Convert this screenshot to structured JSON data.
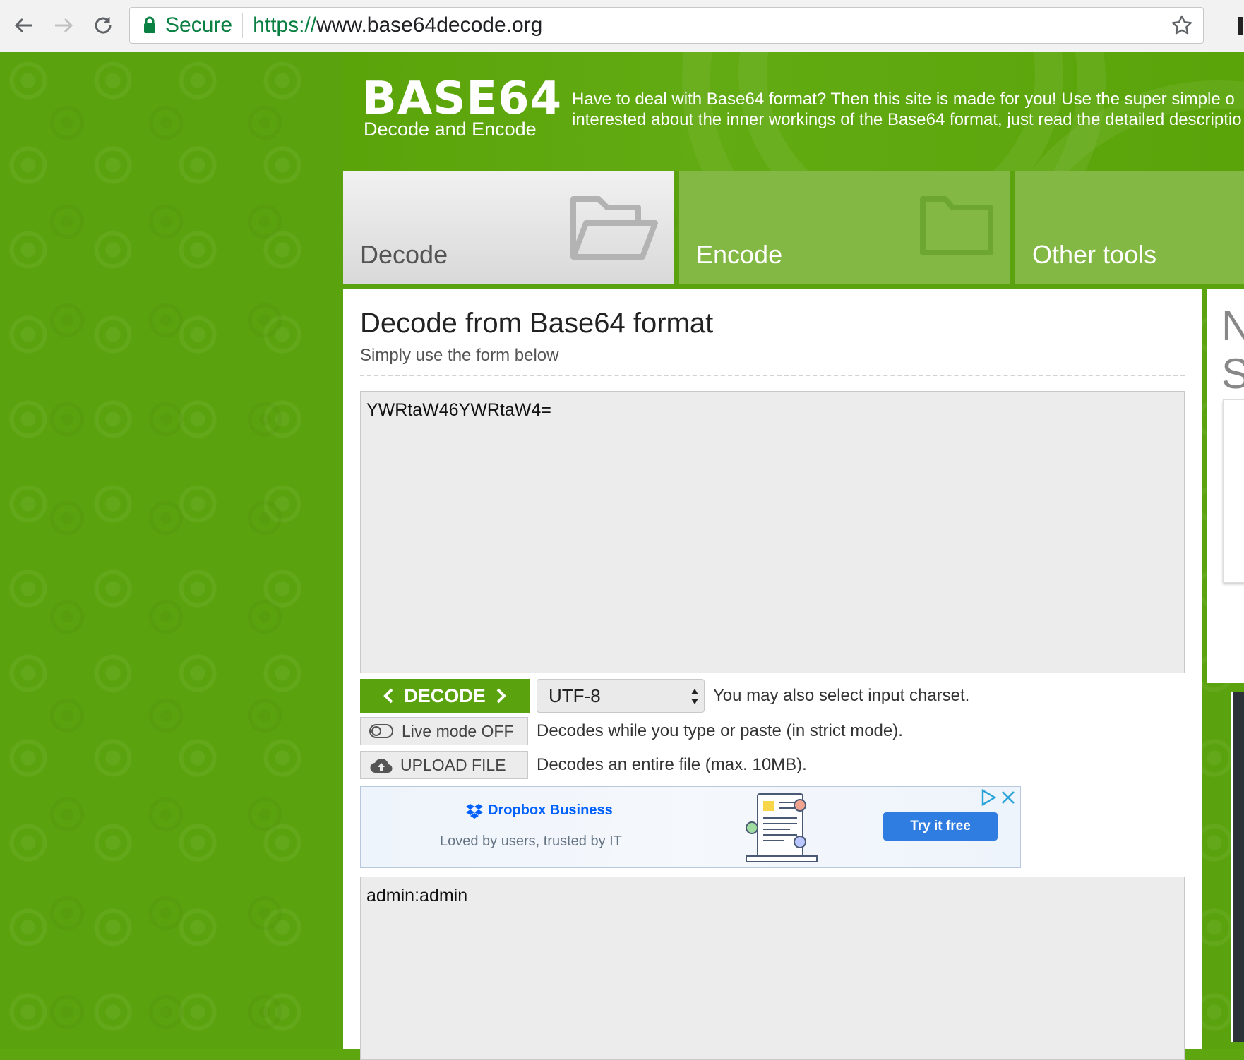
{
  "browser": {
    "secure_label": "Secure",
    "url_scheme": "https://",
    "url_host": "www.base64decode.org"
  },
  "header": {
    "logo_title": "BASE64",
    "logo_subtitle": "Decode and Encode",
    "tagline_line1": "Have to deal with Base64 format? Then this site is made for you! Use the super simple o",
    "tagline_line2": "interested about the inner workings of the Base64 format, just read the detailed descriptio"
  },
  "tabs": [
    {
      "label": "Decode",
      "active": true
    },
    {
      "label": "Encode",
      "active": false
    },
    {
      "label": "Other tools",
      "active": false
    }
  ],
  "main": {
    "title": "Decode from Base64 format",
    "subtitle": "Simply use the form below",
    "input_value": "YWRtaW46YWRtaW4=",
    "decode_button": "DECODE",
    "charset_selected": "UTF-8",
    "charset_help": "You may also select input charset.",
    "live_mode_label": "Live mode OFF",
    "live_mode_help": "Decodes while you type or paste (in strict mode).",
    "upload_label": "UPLOAD FILE",
    "upload_help": "Decodes an entire file (max. 10MB).",
    "output_value": "admin:admin"
  },
  "ad": {
    "brand": "Dropbox Business",
    "tagline": "Loved by users, trusted by IT",
    "cta": "Try it free"
  },
  "side": {
    "letter1": "N",
    "letter2": "S"
  },
  "colors": {
    "brand_green": "#5ba30e",
    "secure_green": "#0b8043",
    "ad_blue": "#2f7de1"
  }
}
